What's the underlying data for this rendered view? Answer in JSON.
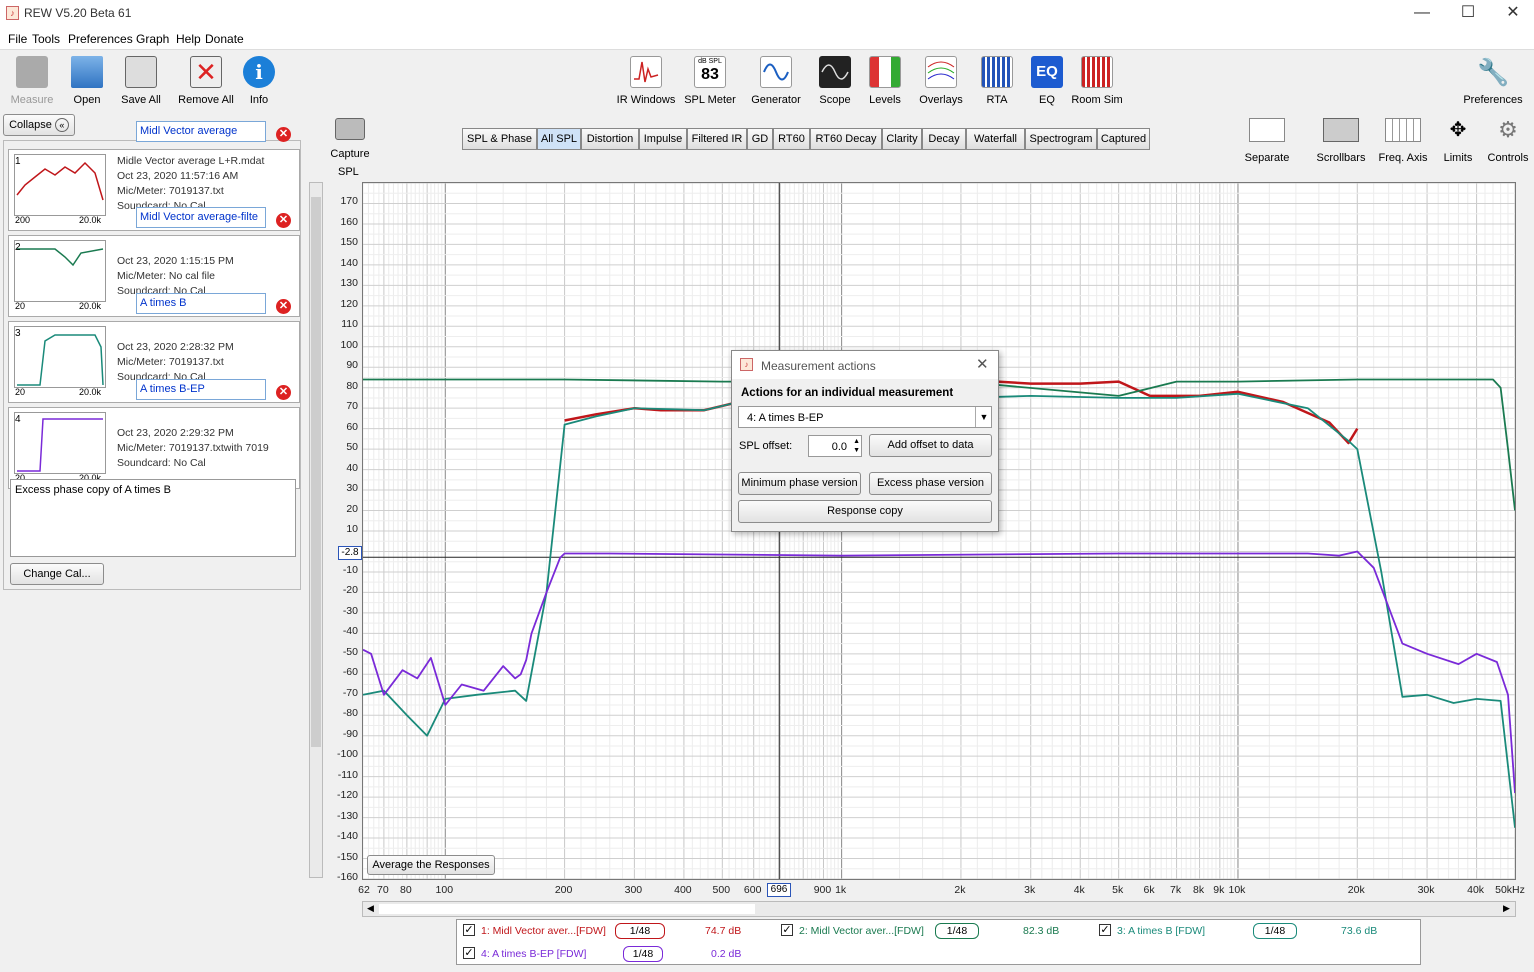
{
  "window": {
    "title": "REW V5.20 Beta 61",
    "minimize": "—",
    "maximize": "☐",
    "close": "✕"
  },
  "menu": [
    "File",
    "Tools",
    "Preferences",
    "Graph",
    "Help",
    "Donate"
  ],
  "toolbar": {
    "left": [
      {
        "label": "Measure",
        "icon": "measure-icon"
      },
      {
        "label": "Open",
        "icon": "folder-icon"
      },
      {
        "label": "Save All",
        "icon": "save-icon"
      },
      {
        "label": "Remove All",
        "icon": "remove-icon"
      },
      {
        "label": "Info",
        "icon": "info-icon"
      }
    ],
    "center": [
      {
        "label": "IR Windows",
        "icon": "ir-windows-icon"
      },
      {
        "label": "SPL Meter",
        "icon": "spl-meter-icon",
        "value": "83",
        "unit": "dB SPL"
      },
      {
        "label": "Generator",
        "icon": "generator-icon"
      },
      {
        "label": "Scope",
        "icon": "scope-icon"
      },
      {
        "label": "Levels",
        "icon": "levels-icon"
      },
      {
        "label": "Overlays",
        "icon": "overlays-icon"
      },
      {
        "label": "RTA",
        "icon": "rta-icon"
      },
      {
        "label": "EQ",
        "icon": "eq-icon"
      },
      {
        "label": "Room Sim",
        "icon": "room-sim-icon"
      }
    ],
    "preferences": "Preferences"
  },
  "panel": {
    "collapse": "Collapse",
    "measurements": [
      {
        "index": "1",
        "name": "Midl Vector average",
        "file": "Midle Vector average L+R.mdat",
        "date": "Oct 23, 2020 11:57:16 AM",
        "mic": "Mic/Meter: 7019137.txt",
        "sound": "Soundcard: No Cal",
        "xmin": "200",
        "xmax": "20.0k",
        "color": "#c0161a"
      },
      {
        "index": "2",
        "name": "Midl Vector average-filte",
        "file": "",
        "date": "Oct 23, 2020 1:15:15 PM",
        "mic": "Mic/Meter: No cal file",
        "sound": "Soundcard: No Cal",
        "xmin": "20",
        "xmax": "20.0k",
        "color": "#1a7a50"
      },
      {
        "index": "3",
        "name": "A times B",
        "file": "",
        "date": "Oct 23, 2020 2:28:32 PM",
        "mic": "Mic/Meter: 7019137.txt",
        "sound": "Soundcard: No Cal",
        "xmin": "20",
        "xmax": "20.0k",
        "color": "#1a8a7a"
      },
      {
        "index": "4",
        "name": "A times B-EP",
        "file": "",
        "date": "Oct 23, 2020 2:29:32 PM",
        "mic": "Mic/Meter: 7019137.txtwith 7019",
        "sound": "Soundcard: No Cal",
        "xmin": "20",
        "xmax": "20.0k",
        "color": "#7a2ad8"
      }
    ],
    "notes": "Excess phase copy of A times B",
    "change_cal": "Change Cal..."
  },
  "capture": "Capture",
  "graph_tabs": [
    "SPL & Phase",
    "All SPL",
    "Distortion",
    "Impulse",
    "Filtered IR",
    "GD",
    "RT60",
    "RT60 Decay",
    "Clarity",
    "Decay",
    "Waterfall",
    "Spectrogram",
    "Captured"
  ],
  "selected_tab": "All SPL",
  "right_tools": [
    {
      "label": "Separate",
      "icon": "separate-icon"
    },
    {
      "label": "Scrollbars",
      "icon": "scrollbars-icon"
    },
    {
      "label": "Freq. Axis",
      "icon": "freq-axis-icon"
    },
    {
      "label": "Limits",
      "icon": "limits-icon"
    },
    {
      "label": "Controls",
      "icon": "gear-icon"
    }
  ],
  "axis": {
    "ylabel": "SPL",
    "cursor_y": "-2.8",
    "cursor_x": "696"
  },
  "average_button": "Average the Responses",
  "legend": [
    {
      "label": "1: Midl Vector aver...[FDW]",
      "smoothing": "1/48",
      "value": "74.7 dB",
      "color": "#c0161a"
    },
    {
      "label": "2: Midl Vector aver...[FDW]",
      "smoothing": "1/48",
      "value": "82.3 dB",
      "color": "#1a7a50"
    },
    {
      "label": "3: A times B [FDW]",
      "smoothing": "1/48",
      "value": "73.6 dB",
      "color": "#1a8a7a"
    },
    {
      "label": "4: A times B-EP [FDW]",
      "smoothing": "1/48",
      "value": "0.2 dB",
      "color": "#7a2ad8"
    }
  ],
  "dialog": {
    "title": "Measurement actions",
    "heading": "Actions for an individual measurement",
    "selected": "4: A times B-EP",
    "offset_label": "SPL offset:",
    "offset_value": "0.0",
    "add_offset": "Add offset to data",
    "min_phase": "Minimum phase version",
    "excess_phase": "Excess phase version",
    "response_copy": "Response copy"
  },
  "chart_data": {
    "type": "line",
    "ylabel": "SPL",
    "xscale": "log",
    "xlim": [
      62,
      50000
    ],
    "ylim": [
      -160,
      180
    ],
    "yticks": [
      170,
      160,
      150,
      140,
      130,
      120,
      110,
      100,
      90,
      80,
      70,
      60,
      50,
      40,
      30,
      20,
      10,
      -10,
      -20,
      -30,
      -40,
      -50,
      -60,
      -70,
      -80,
      -90,
      -100,
      -110,
      -120,
      -130,
      -140,
      -150,
      -160
    ],
    "xticks": [
      {
        "v": 62,
        "t": "62"
      },
      {
        "v": 70,
        "t": "70"
      },
      {
        "v": 80,
        "t": "80"
      },
      {
        "v": 100,
        "t": "100"
      },
      {
        "v": 200,
        "t": "200"
      },
      {
        "v": 300,
        "t": "300"
      },
      {
        "v": 400,
        "t": "400"
      },
      {
        "v": 500,
        "t": "500"
      },
      {
        "v": 600,
        "t": "600"
      },
      {
        "v": 900,
        "t": "900"
      },
      {
        "v": 1000,
        "t": "1k"
      },
      {
        "v": 2000,
        "t": "2k"
      },
      {
        "v": 3000,
        "t": "3k"
      },
      {
        "v": 4000,
        "t": "4k"
      },
      {
        "v": 5000,
        "t": "5k"
      },
      {
        "v": 6000,
        "t": "6k"
      },
      {
        "v": 7000,
        "t": "7k"
      },
      {
        "v": 8000,
        "t": "8k"
      },
      {
        "v": 9000,
        "t": "9k"
      },
      {
        "v": 10000,
        "t": "10k"
      },
      {
        "v": 20000,
        "t": "20k"
      },
      {
        "v": 30000,
        "t": "30k"
      },
      {
        "v": 40000,
        "t": "40k"
      },
      {
        "v": 50000,
        "t": "50kHz"
      }
    ],
    "series": [
      {
        "name": "1: Midl Vector aver...[FDW]",
        "color": "#c0161a",
        "points": [
          [
            200,
            64
          ],
          [
            240,
            67
          ],
          [
            300,
            70
          ],
          [
            350,
            69
          ],
          [
            450,
            69
          ],
          [
            550,
            73
          ],
          [
            650,
            74
          ],
          [
            1000,
            76
          ],
          [
            1500,
            78
          ],
          [
            2000,
            84
          ],
          [
            3000,
            82
          ],
          [
            4000,
            82
          ],
          [
            5000,
            83
          ],
          [
            6000,
            76
          ],
          [
            8000,
            76
          ],
          [
            10000,
            78
          ],
          [
            13000,
            73
          ],
          [
            17000,
            63
          ],
          [
            19000,
            53
          ],
          [
            20000,
            60
          ]
        ]
      },
      {
        "name": "2: Midl Vector aver...[FDW]",
        "color": "#1a7a50",
        "points": [
          [
            62,
            84
          ],
          [
            200,
            84
          ],
          [
            500,
            83
          ],
          [
            1000,
            83
          ],
          [
            2000,
            83
          ],
          [
            5000,
            76
          ],
          [
            7000,
            83
          ],
          [
            10000,
            83
          ],
          [
            20000,
            84
          ],
          [
            30000,
            84
          ],
          [
            44000,
            84
          ],
          [
            46000,
            80
          ],
          [
            48000,
            50
          ],
          [
            50000,
            20
          ]
        ]
      },
      {
        "name": "3: A times B [FDW]",
        "color": "#1a8a7a",
        "points": [
          [
            62,
            -70
          ],
          [
            70,
            -68
          ],
          [
            80,
            -80
          ],
          [
            90,
            -90
          ],
          [
            100,
            -72
          ],
          [
            120,
            -70
          ],
          [
            150,
            -68
          ],
          [
            160,
            -73
          ],
          [
            180,
            -20
          ],
          [
            200,
            62
          ],
          [
            240,
            66
          ],
          [
            300,
            70
          ],
          [
            450,
            69
          ],
          [
            550,
            73
          ],
          [
            700,
            74
          ],
          [
            1000,
            75
          ],
          [
            2000,
            75
          ],
          [
            3000,
            76
          ],
          [
            5000,
            75
          ],
          [
            7000,
            75
          ],
          [
            10000,
            77
          ],
          [
            15000,
            70
          ],
          [
            19000,
            54
          ],
          [
            20000,
            50
          ],
          [
            23000,
            -10
          ],
          [
            26000,
            -71
          ],
          [
            30000,
            -70
          ],
          [
            35000,
            -74
          ],
          [
            40000,
            -72
          ],
          [
            46000,
            -73
          ],
          [
            50000,
            -135
          ]
        ]
      },
      {
        "name": "4: A times B-EP [FDW]",
        "color": "#7a2ad8",
        "points": [
          [
            62,
            -48
          ],
          [
            65,
            -50
          ],
          [
            70,
            -70
          ],
          [
            78,
            -58
          ],
          [
            85,
            -62
          ],
          [
            92,
            -52
          ],
          [
            100,
            -75
          ],
          [
            110,
            -65
          ],
          [
            125,
            -68
          ],
          [
            140,
            -56
          ],
          [
            150,
            -62
          ],
          [
            155,
            -60
          ],
          [
            160,
            -53
          ],
          [
            165,
            -40
          ],
          [
            180,
            -20
          ],
          [
            195,
            -3
          ],
          [
            200,
            -1
          ],
          [
            260,
            -1
          ],
          [
            1000,
            -2
          ],
          [
            5000,
            -1
          ],
          [
            15000,
            -1
          ],
          [
            18000,
            -2
          ],
          [
            20000,
            0
          ],
          [
            22000,
            -8
          ],
          [
            26000,
            -45
          ],
          [
            30000,
            -50
          ],
          [
            36000,
            -55
          ],
          [
            40000,
            -50
          ],
          [
            45000,
            -54
          ],
          [
            48000,
            -70
          ],
          [
            50000,
            -118
          ]
        ]
      }
    ]
  }
}
